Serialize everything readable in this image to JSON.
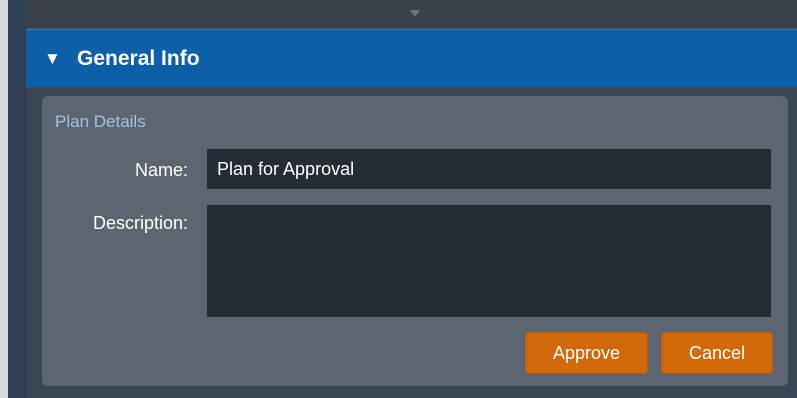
{
  "section": {
    "toggle_icon": "▼",
    "title": "General Info"
  },
  "fieldset": {
    "legend": "Plan Details"
  },
  "form": {
    "name_label": "Name:",
    "name_value": "Plan for Approval",
    "description_label": "Description:",
    "description_value": ""
  },
  "actions": {
    "approve_label": "Approve",
    "cancel_label": "Cancel"
  },
  "colors": {
    "header_blue": "#0d5fa8",
    "button_orange": "#d1680b",
    "legend_blue": "#9cc4e6",
    "panel_gray": "#5d6670",
    "input_dark": "#252c33"
  }
}
